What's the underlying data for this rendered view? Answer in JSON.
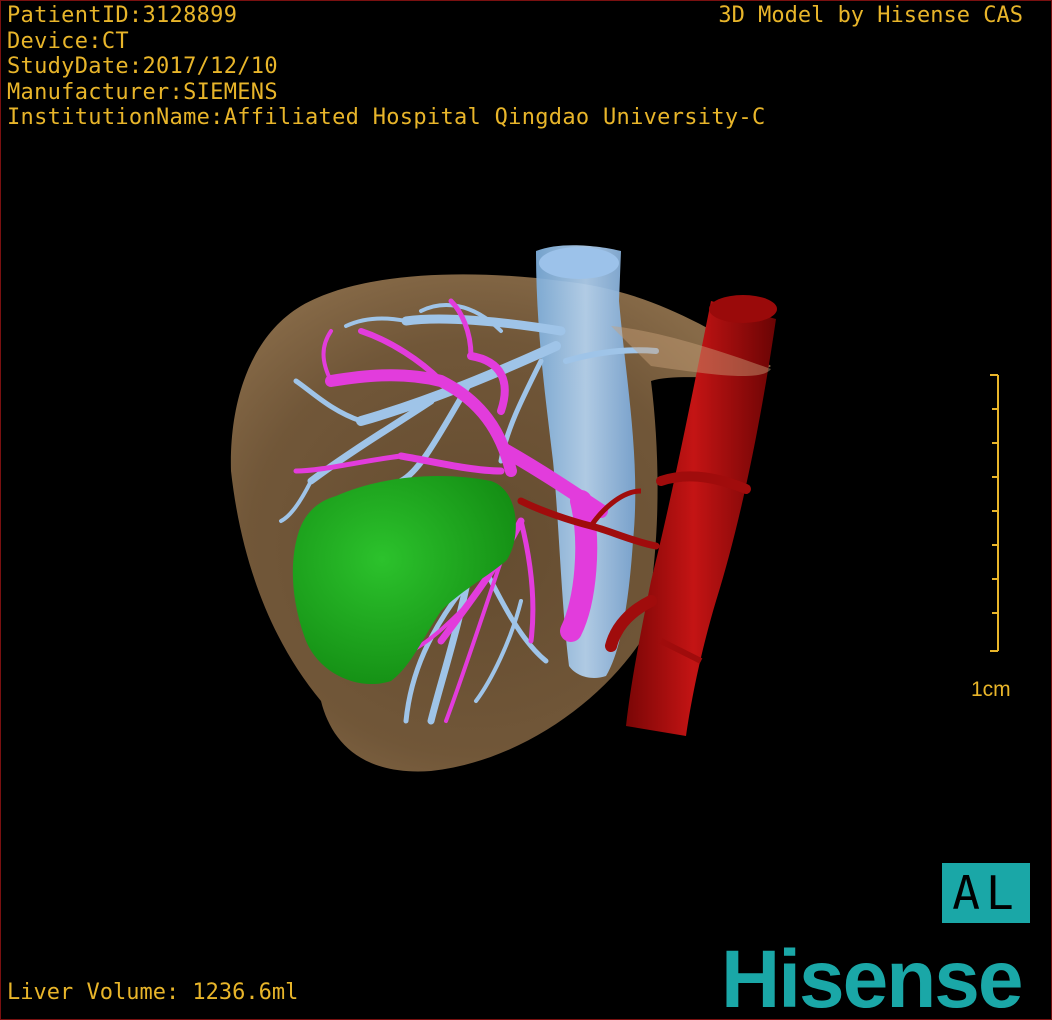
{
  "patient": {
    "id_line": "PatientID:3128899",
    "device_line": "Device:CT",
    "study_date_line": "StudyDate:2017/12/10",
    "manufacturer_line": "Manufacturer:SIEMENS",
    "institution_line": "InstitutionName:Affiliated Hospital Qingdao University-C"
  },
  "header": {
    "credit": "3D Model by Hisense CAS"
  },
  "footer": {
    "volume": "Liver Volume: 1236.6ml"
  },
  "scale": {
    "label": "1cm"
  },
  "orientation": {
    "label": "AL"
  },
  "brand": {
    "logo_text": "Hisense"
  },
  "colors": {
    "text": "#e8b52a",
    "liver": "#8a6a45",
    "tumor": "#1fa81f",
    "portal_vein": "#e23cdc",
    "hepatic_vein": "#9fc4e8",
    "artery": "#b01010",
    "brand": "#1aa7a7"
  }
}
